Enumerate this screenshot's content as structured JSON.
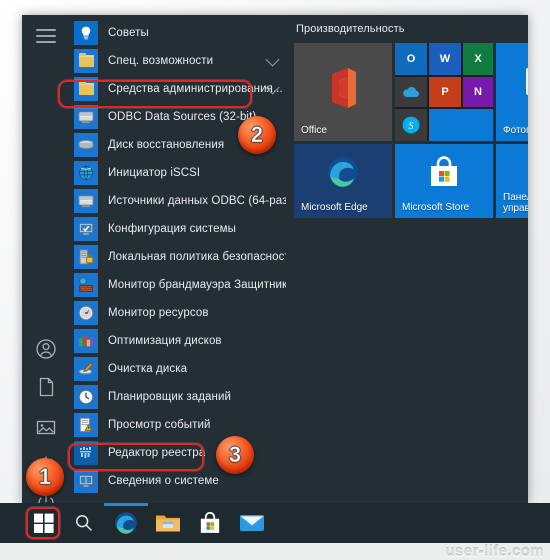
{
  "window": {
    "os": "Windows 10 Start Menu",
    "hamburger_label": "Открыть меню"
  },
  "rail": {
    "items": [
      {
        "name": "account-icon",
        "label": "Учетные записи"
      },
      {
        "name": "documents-icon",
        "label": "Документы"
      },
      {
        "name": "pictures-icon",
        "label": "Изображения"
      },
      {
        "name": "settings-icon",
        "label": "Параметры"
      },
      {
        "name": "power-icon",
        "label": "Выключение"
      }
    ]
  },
  "app_list": [
    {
      "label": "Советы",
      "icon": "tips-icon",
      "type": "app",
      "highlighted": false,
      "chevron": false
    },
    {
      "label": "Спец. возможности",
      "icon": "folder-icon",
      "type": "folder",
      "highlighted": false,
      "chevron": true
    },
    {
      "label": "Средства администрирования...",
      "icon": "folder-icon",
      "type": "folder",
      "highlighted": true,
      "chevron": true
    },
    {
      "label": "ODBC Data Sources (32-bit)",
      "icon": "odbc-icon",
      "type": "app",
      "highlighted": false,
      "chevron": false
    },
    {
      "label": "Диск восстановления",
      "icon": "recovery-drive-icon",
      "type": "app",
      "highlighted": false,
      "chevron": false
    },
    {
      "label": "Инициатор iSCSI",
      "icon": "iscsi-icon",
      "type": "app",
      "highlighted": false,
      "chevron": false
    },
    {
      "label": "Источники данных ODBC (64-раз...",
      "icon": "odbc64-icon",
      "type": "app",
      "highlighted": false,
      "chevron": false
    },
    {
      "label": "Конфигурация системы",
      "icon": "msconfig-icon",
      "type": "app",
      "highlighted": false,
      "chevron": false
    },
    {
      "label": "Локальная политика безопасности",
      "icon": "security-policy-icon",
      "type": "app",
      "highlighted": false,
      "chevron": false
    },
    {
      "label": "Монитор брандмауэра Защитник...",
      "icon": "firewall-monitor-icon",
      "type": "app",
      "highlighted": false,
      "chevron": false
    },
    {
      "label": "Монитор ресурсов",
      "icon": "resource-monitor-icon",
      "type": "app",
      "highlighted": false,
      "chevron": false
    },
    {
      "label": "Оптимизация дисков",
      "icon": "defrag-icon",
      "type": "app",
      "highlighted": false,
      "chevron": false
    },
    {
      "label": "Очистка диска",
      "icon": "disk-cleanup-icon",
      "type": "app",
      "highlighted": false,
      "chevron": false
    },
    {
      "label": "Планировщик заданий",
      "icon": "task-scheduler-icon",
      "type": "app",
      "highlighted": false,
      "chevron": false
    },
    {
      "label": "Просмотр событий",
      "icon": "event-viewer-icon",
      "type": "app",
      "highlighted": false,
      "chevron": false
    },
    {
      "label": "Редактор реестра",
      "icon": "registry-editor-icon",
      "type": "app",
      "highlighted": true,
      "chevron": false
    },
    {
      "label": "Сведения о системе",
      "icon": "system-info-icon",
      "type": "app",
      "highlighted": false,
      "chevron": false
    }
  ],
  "tiles": {
    "group_title": "Производительность",
    "items": [
      {
        "name": "tile-office",
        "label": "Office",
        "color": "#4a4a4a"
      },
      {
        "name": "tile-office-suite",
        "label": "",
        "color": "#0b6fc4"
      },
      {
        "name": "tile-photos",
        "label": "Фотографии",
        "color": "#0b7ad6"
      },
      {
        "name": "tile-microsoft-edge",
        "label": "Microsoft Edge",
        "color": "#1b3f73"
      },
      {
        "name": "tile-microsoft-store",
        "label": "Microsoft Store",
        "color": "#0b7ad6"
      },
      {
        "name": "tile-control-panel",
        "label": "Панель\nуправления",
        "label_line1": "Панель",
        "label_line2": "управления",
        "color": "#0b7ad6"
      }
    ]
  },
  "taskbar": {
    "items": [
      {
        "name": "start-button",
        "label": "Пуск"
      },
      {
        "name": "search-icon",
        "label": "Поиск"
      },
      {
        "name": "edge-icon",
        "label": "Microsoft Edge"
      },
      {
        "name": "file-explorer-icon",
        "label": "Проводник"
      },
      {
        "name": "microsoft-store-icon",
        "label": "Microsoft Store"
      },
      {
        "name": "mail-icon",
        "label": "Почта"
      }
    ]
  },
  "annotations": {
    "badges": [
      {
        "number": "1",
        "target": "start-button"
      },
      {
        "number": "2",
        "target": "administrative-tools-row"
      },
      {
        "number": "3",
        "target": "registry-editor-row"
      }
    ],
    "accent_color": "#e8241e"
  },
  "watermark": {
    "text": "user-life.com"
  }
}
